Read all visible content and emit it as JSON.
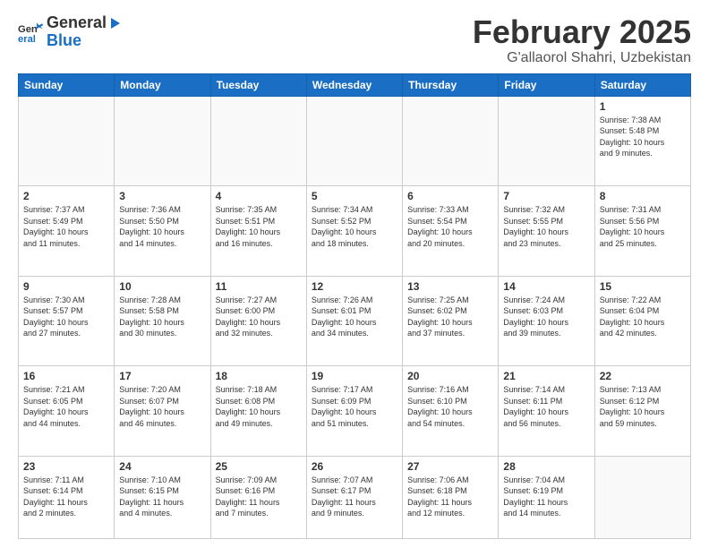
{
  "header": {
    "logo_line1": "General",
    "logo_line2": "Blue",
    "month_title": "February 2025",
    "subtitle": "G'allaorol Shahri, Uzbekistan"
  },
  "weekdays": [
    "Sunday",
    "Monday",
    "Tuesday",
    "Wednesday",
    "Thursday",
    "Friday",
    "Saturday"
  ],
  "weeks": [
    [
      {
        "day": "",
        "info": ""
      },
      {
        "day": "",
        "info": ""
      },
      {
        "day": "",
        "info": ""
      },
      {
        "day": "",
        "info": ""
      },
      {
        "day": "",
        "info": ""
      },
      {
        "day": "",
        "info": ""
      },
      {
        "day": "1",
        "info": "Sunrise: 7:38 AM\nSunset: 5:48 PM\nDaylight: 10 hours\nand 9 minutes."
      }
    ],
    [
      {
        "day": "2",
        "info": "Sunrise: 7:37 AM\nSunset: 5:49 PM\nDaylight: 10 hours\nand 11 minutes."
      },
      {
        "day": "3",
        "info": "Sunrise: 7:36 AM\nSunset: 5:50 PM\nDaylight: 10 hours\nand 14 minutes."
      },
      {
        "day": "4",
        "info": "Sunrise: 7:35 AM\nSunset: 5:51 PM\nDaylight: 10 hours\nand 16 minutes."
      },
      {
        "day": "5",
        "info": "Sunrise: 7:34 AM\nSunset: 5:52 PM\nDaylight: 10 hours\nand 18 minutes."
      },
      {
        "day": "6",
        "info": "Sunrise: 7:33 AM\nSunset: 5:54 PM\nDaylight: 10 hours\nand 20 minutes."
      },
      {
        "day": "7",
        "info": "Sunrise: 7:32 AM\nSunset: 5:55 PM\nDaylight: 10 hours\nand 23 minutes."
      },
      {
        "day": "8",
        "info": "Sunrise: 7:31 AM\nSunset: 5:56 PM\nDaylight: 10 hours\nand 25 minutes."
      }
    ],
    [
      {
        "day": "9",
        "info": "Sunrise: 7:30 AM\nSunset: 5:57 PM\nDaylight: 10 hours\nand 27 minutes."
      },
      {
        "day": "10",
        "info": "Sunrise: 7:28 AM\nSunset: 5:58 PM\nDaylight: 10 hours\nand 30 minutes."
      },
      {
        "day": "11",
        "info": "Sunrise: 7:27 AM\nSunset: 6:00 PM\nDaylight: 10 hours\nand 32 minutes."
      },
      {
        "day": "12",
        "info": "Sunrise: 7:26 AM\nSunset: 6:01 PM\nDaylight: 10 hours\nand 34 minutes."
      },
      {
        "day": "13",
        "info": "Sunrise: 7:25 AM\nSunset: 6:02 PM\nDaylight: 10 hours\nand 37 minutes."
      },
      {
        "day": "14",
        "info": "Sunrise: 7:24 AM\nSunset: 6:03 PM\nDaylight: 10 hours\nand 39 minutes."
      },
      {
        "day": "15",
        "info": "Sunrise: 7:22 AM\nSunset: 6:04 PM\nDaylight: 10 hours\nand 42 minutes."
      }
    ],
    [
      {
        "day": "16",
        "info": "Sunrise: 7:21 AM\nSunset: 6:05 PM\nDaylight: 10 hours\nand 44 minutes."
      },
      {
        "day": "17",
        "info": "Sunrise: 7:20 AM\nSunset: 6:07 PM\nDaylight: 10 hours\nand 46 minutes."
      },
      {
        "day": "18",
        "info": "Sunrise: 7:18 AM\nSunset: 6:08 PM\nDaylight: 10 hours\nand 49 minutes."
      },
      {
        "day": "19",
        "info": "Sunrise: 7:17 AM\nSunset: 6:09 PM\nDaylight: 10 hours\nand 51 minutes."
      },
      {
        "day": "20",
        "info": "Sunrise: 7:16 AM\nSunset: 6:10 PM\nDaylight: 10 hours\nand 54 minutes."
      },
      {
        "day": "21",
        "info": "Sunrise: 7:14 AM\nSunset: 6:11 PM\nDaylight: 10 hours\nand 56 minutes."
      },
      {
        "day": "22",
        "info": "Sunrise: 7:13 AM\nSunset: 6:12 PM\nDaylight: 10 hours\nand 59 minutes."
      }
    ],
    [
      {
        "day": "23",
        "info": "Sunrise: 7:11 AM\nSunset: 6:14 PM\nDaylight: 11 hours\nand 2 minutes."
      },
      {
        "day": "24",
        "info": "Sunrise: 7:10 AM\nSunset: 6:15 PM\nDaylight: 11 hours\nand 4 minutes."
      },
      {
        "day": "25",
        "info": "Sunrise: 7:09 AM\nSunset: 6:16 PM\nDaylight: 11 hours\nand 7 minutes."
      },
      {
        "day": "26",
        "info": "Sunrise: 7:07 AM\nSunset: 6:17 PM\nDaylight: 11 hours\nand 9 minutes."
      },
      {
        "day": "27",
        "info": "Sunrise: 7:06 AM\nSunset: 6:18 PM\nDaylight: 11 hours\nand 12 minutes."
      },
      {
        "day": "28",
        "info": "Sunrise: 7:04 AM\nSunset: 6:19 PM\nDaylight: 11 hours\nand 14 minutes."
      },
      {
        "day": "",
        "info": ""
      }
    ]
  ]
}
